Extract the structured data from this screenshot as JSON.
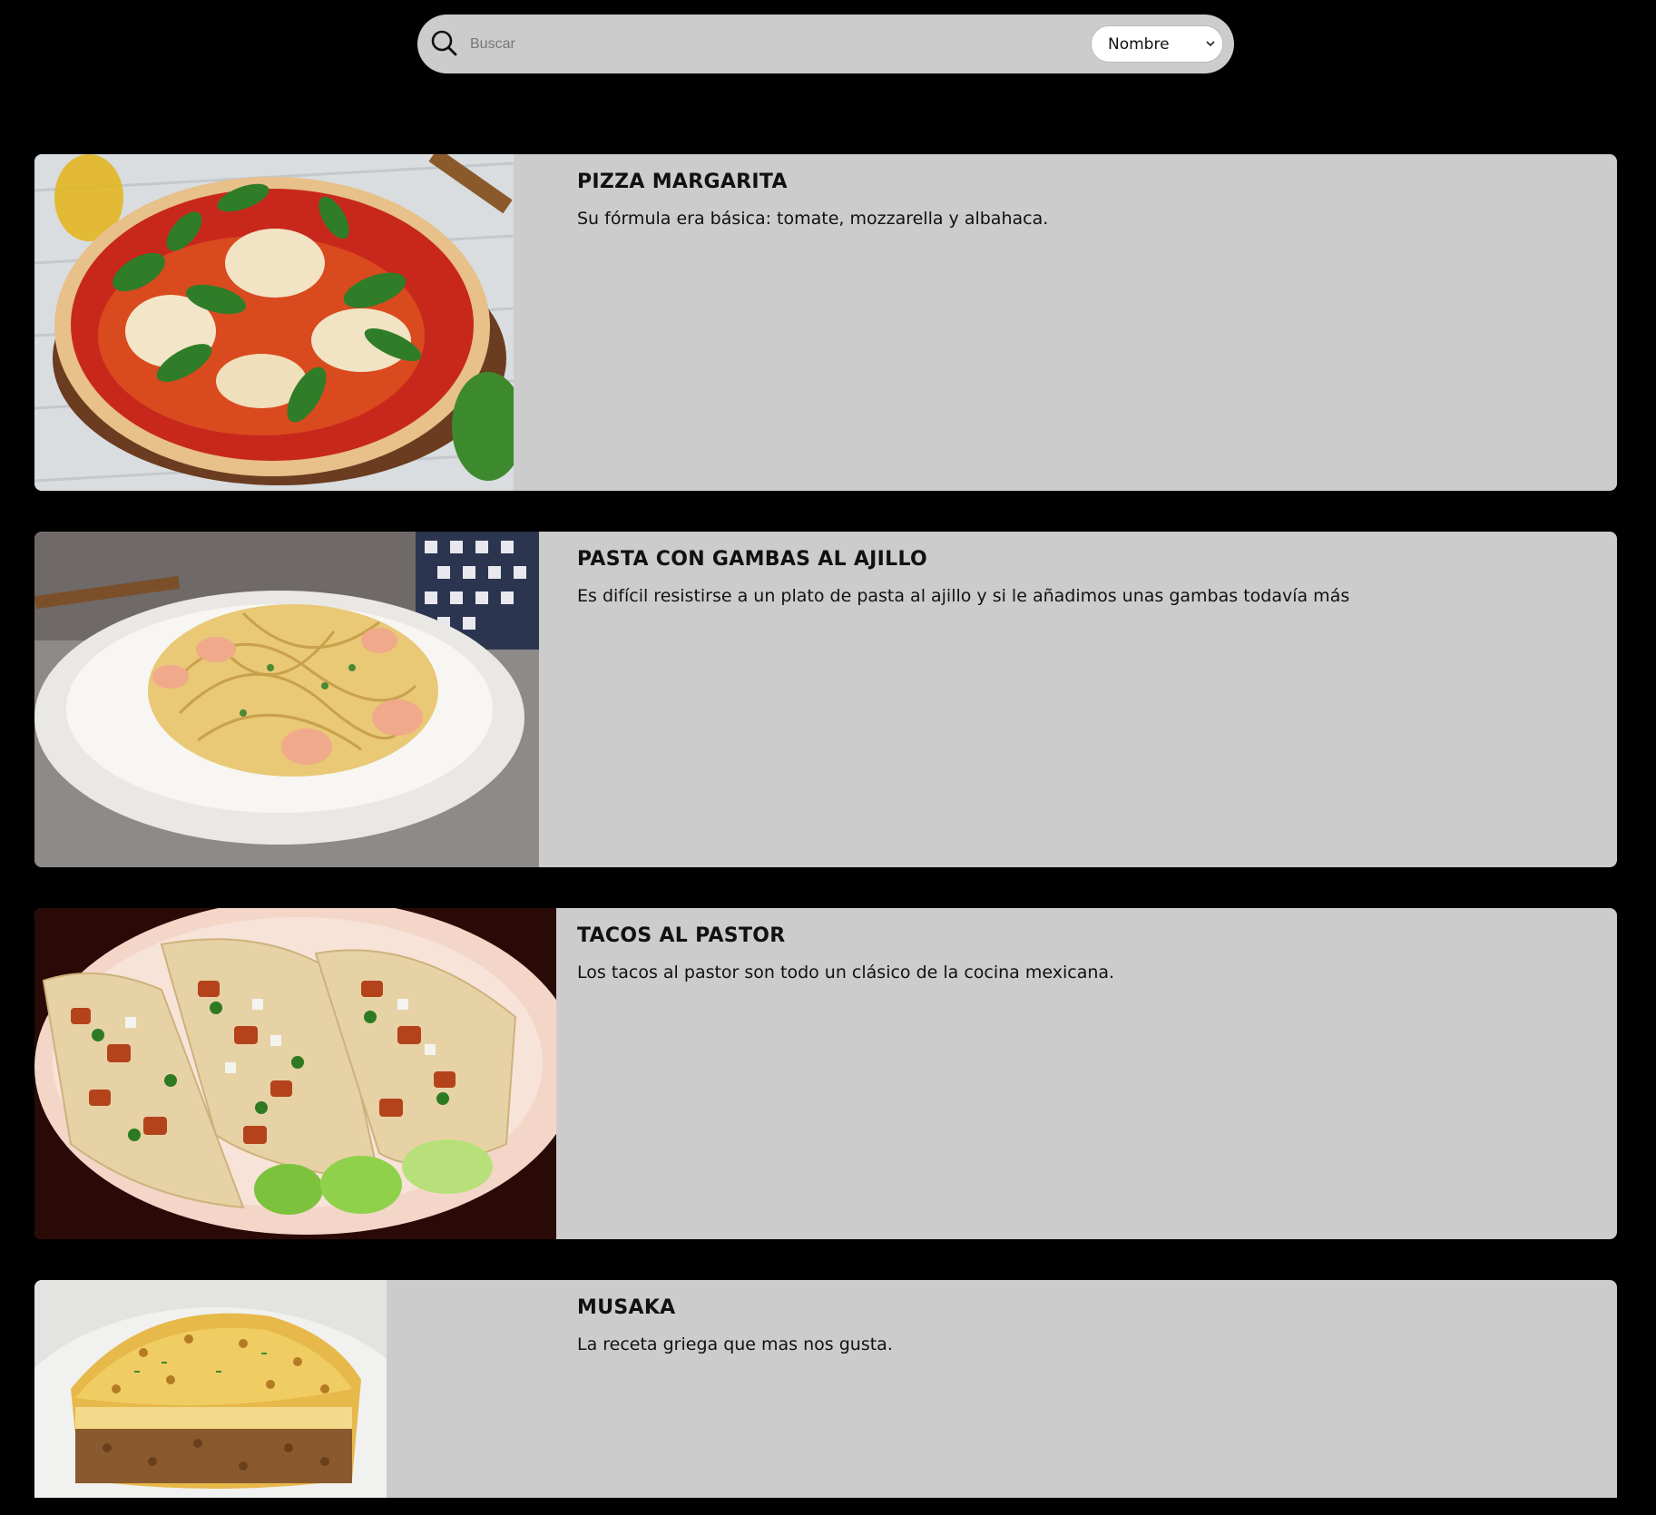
{
  "search": {
    "placeholder": "Buscar",
    "sort_value": "Nombre"
  },
  "recipes": [
    {
      "title": "PIZZA MARGARITA",
      "description": "Su fórmula era básica: tomate, mozzarella y albahaca."
    },
    {
      "title": "PASTA CON GAMBAS AL AJILLO",
      "description": "Es difícil resistirse a un plato de pasta al ajillo y si le añadimos unas gambas todavía más"
    },
    {
      "title": "TACOS AL PASTOR",
      "description": "Los tacos al pastor son todo un clásico de la cocina mexicana."
    },
    {
      "title": "MUSAKA",
      "description": "La receta griega que mas nos gusta."
    }
  ],
  "colors": {
    "background": "#000000",
    "card": "#cccccc",
    "text": "#111111"
  }
}
